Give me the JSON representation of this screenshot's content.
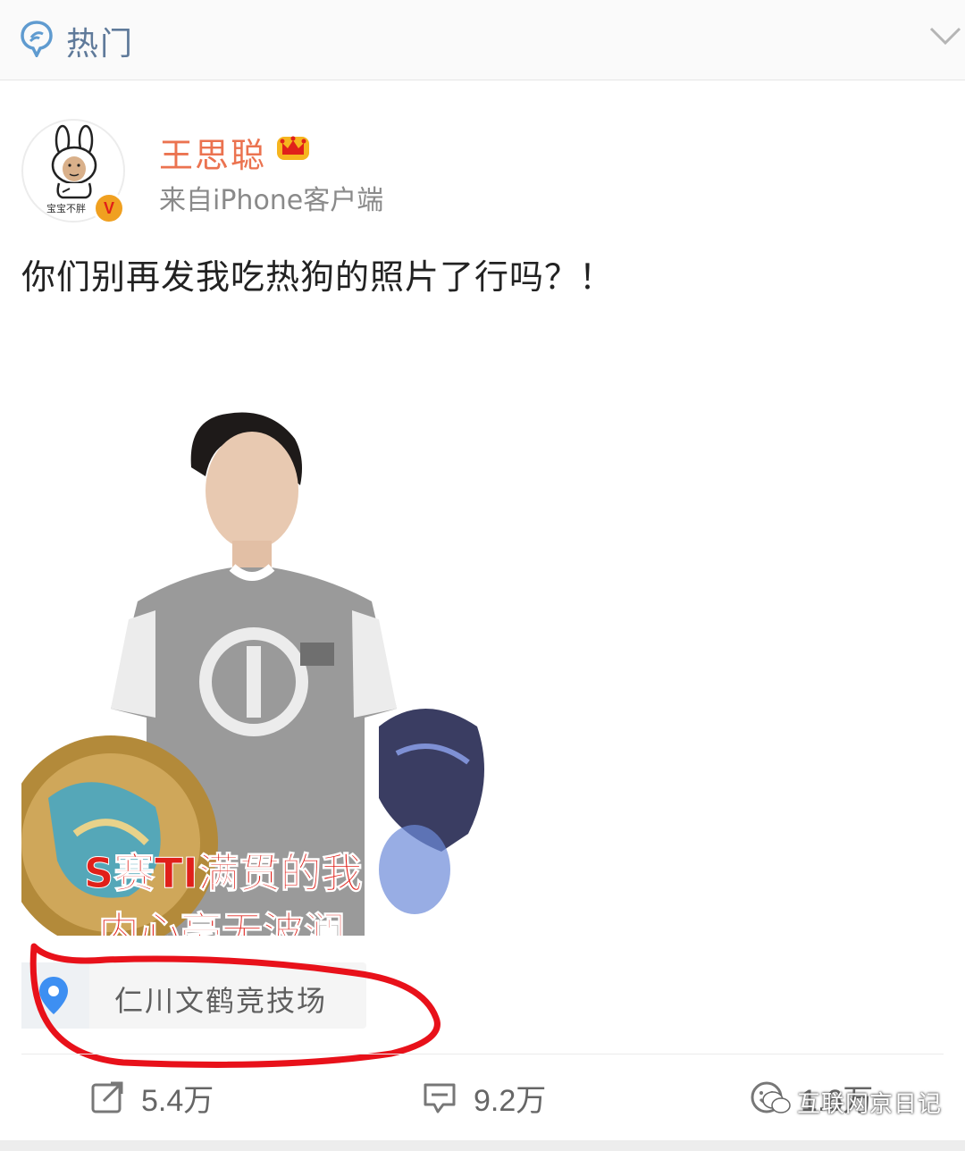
{
  "header": {
    "title": "热门"
  },
  "post": {
    "author": "王思聪",
    "avatar_caption": "宝宝不胖",
    "verified_mark": "V",
    "source": "来自iPhone客户端",
    "text": "你们别再发我吃热狗的照片了行吗？！",
    "image": {
      "caption_line1": "S赛TI满贯的我",
      "caption_line2": "内心毫无波澜"
    },
    "location": "仁川文鹤竞技场"
  },
  "actions": {
    "repost_count": "5.4万",
    "comment_count": "9.2万",
    "like_count": "1.6万"
  },
  "watermark": {
    "text": "互联网京日记"
  },
  "colors": {
    "username": "#eb7350",
    "header_text": "#5f7a9a",
    "location_pin": "#3d8ff2",
    "annotation_circle": "#e8111a",
    "caption_red": "#e0201a"
  },
  "icons": {
    "header": "chat-bubble-icon",
    "collapse": "chevron-down-icon",
    "member": "crown-icon",
    "location": "location-pin-icon",
    "repost": "repost-icon",
    "comment": "comment-icon",
    "like": "like-icon"
  }
}
